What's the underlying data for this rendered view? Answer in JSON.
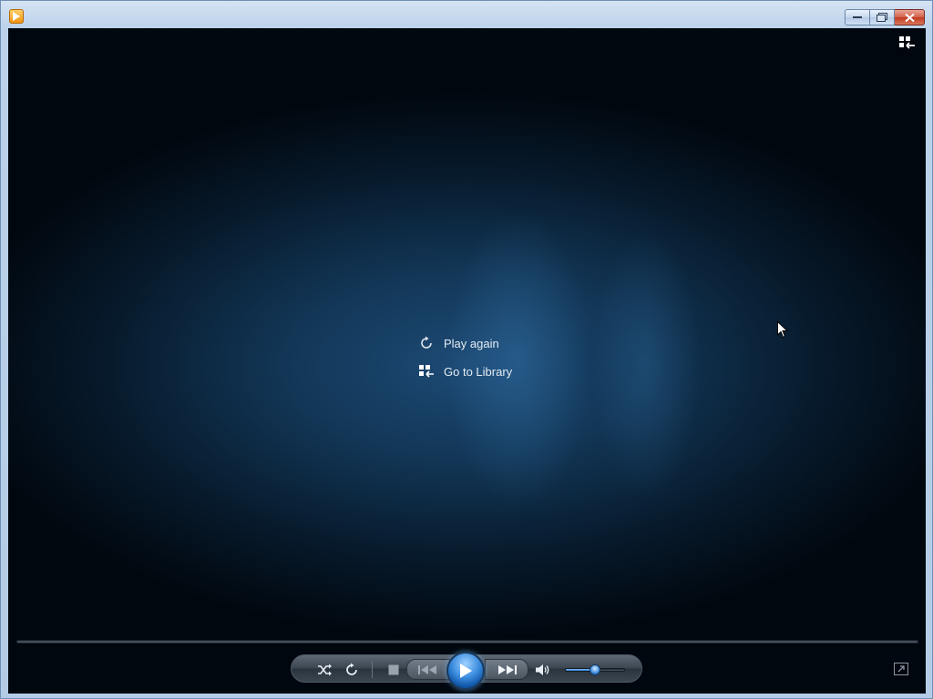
{
  "window": {
    "accent": "#1157a8",
    "icon": "media-player-icon",
    "buttons": {
      "minimize": "minimize-icon",
      "maximize": "maximize-icon",
      "close": "close-icon"
    }
  },
  "overlay": {
    "play_again_label": "Play again",
    "go_to_library_label": "Go to Library"
  },
  "controls": {
    "shuffle": "shuffle-icon",
    "repeat": "repeat-icon",
    "stop": "stop-icon",
    "previous": "previous-icon",
    "play": "play-icon",
    "next": "next-icon",
    "mute": "speaker-icon",
    "volume_level": 0.5,
    "seek_position": 0
  }
}
